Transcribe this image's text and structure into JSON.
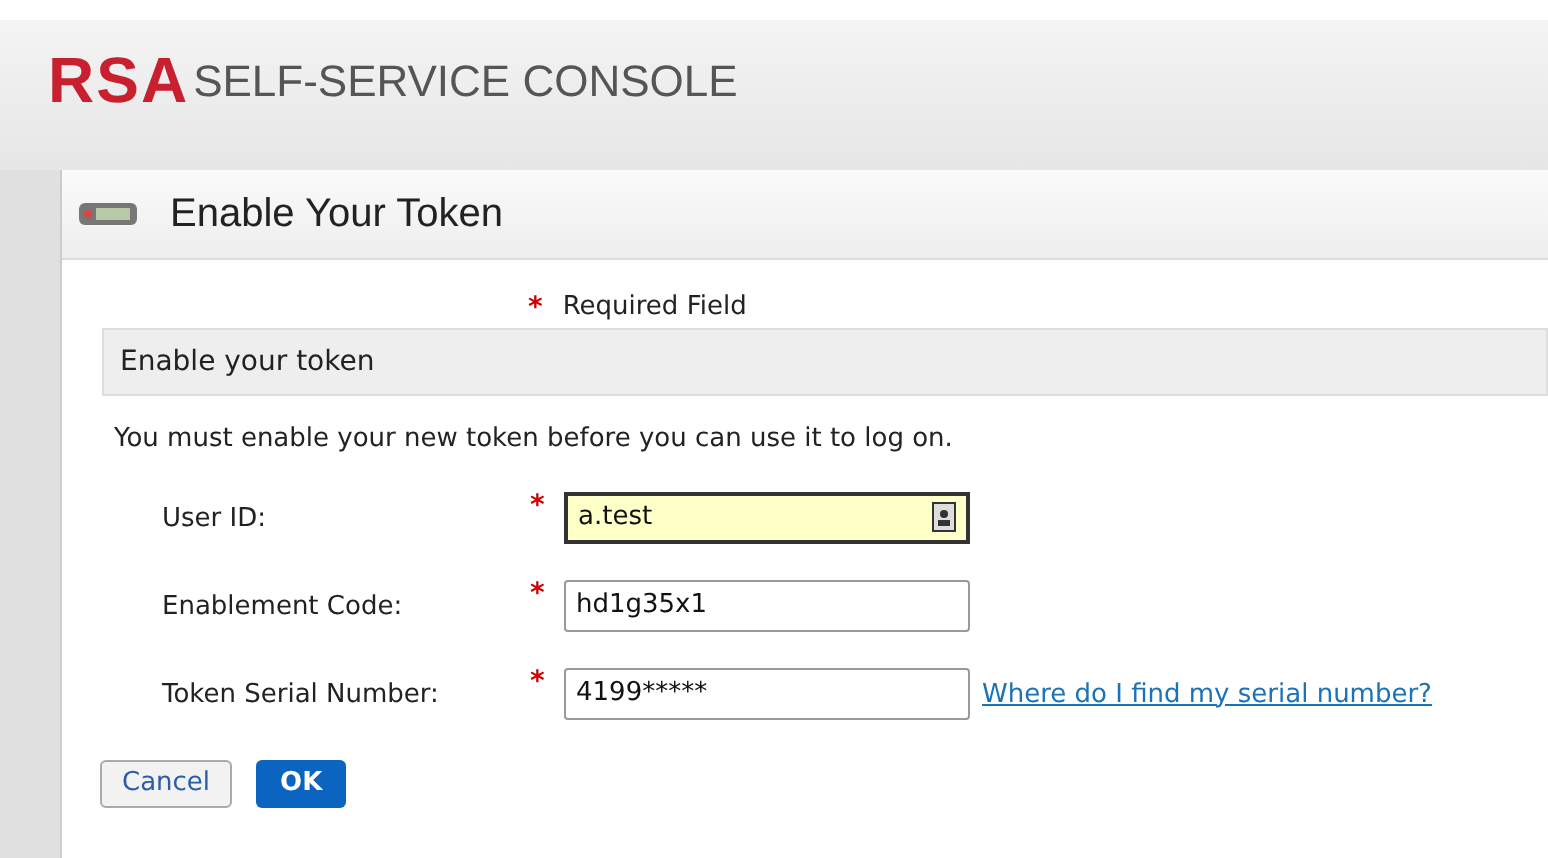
{
  "header": {
    "logo": "RSA",
    "title": "SELF-SERVICE CONSOLE"
  },
  "panel": {
    "title": "Enable Your Token",
    "required_mark": "*",
    "required_note": "Required Field",
    "section_title": "Enable your token",
    "instructions": "You must enable your new token before you can use it to log on.",
    "fields": [
      {
        "label": "User ID:",
        "mark": "*",
        "value": "a.test",
        "focused": true
      },
      {
        "label": "Enablement Code:",
        "mark": "*",
        "value": "hd1g35x1",
        "focused": false
      },
      {
        "label": "Token Serial Number:",
        "mark": "*",
        "value": "4199*****",
        "focused": false,
        "link": "Where do I find my serial number?"
      }
    ],
    "buttons": [
      {
        "label": "Cancel",
        "kind": "secondary"
      },
      {
        "label": "OK",
        "kind": "primary"
      }
    ]
  }
}
